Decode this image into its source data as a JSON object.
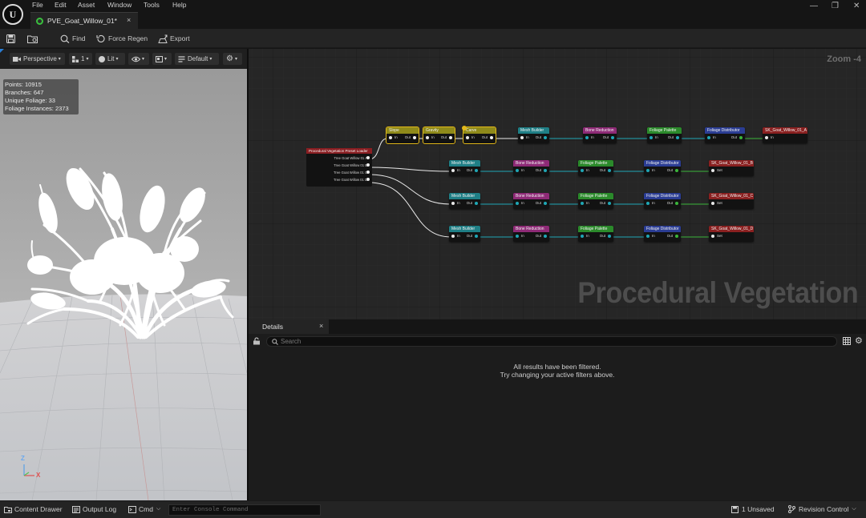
{
  "menu": {
    "items": [
      "File",
      "Edit",
      "Asset",
      "Window",
      "Tools",
      "Help"
    ]
  },
  "document_tab": {
    "label": "PVE_Goat_Willow_01*",
    "close": "×"
  },
  "window_controls": {
    "minimize": "—",
    "maximize": "❐",
    "close": "✕"
  },
  "toolbar": {
    "find_label": "Find",
    "force_regen_label": "Force Regen",
    "export_label": "Export"
  },
  "viewport": {
    "view_mode": "Perspective",
    "camera_speed": "1",
    "lighting_mode": "Lit",
    "profile": "Default",
    "stats": {
      "points": "Points: 10915",
      "branches": "Branches: 647",
      "unique_foliage": "Unique Foliage: 33",
      "foliage_instances": "Foliage Instances: 2373"
    },
    "axis": {
      "z": "Z",
      "x": "X"
    }
  },
  "graph": {
    "zoom_label": "Zoom -4",
    "watermark": "Procedural Vegetation",
    "loader": {
      "title": "Procedural Vegetation Preset Loader",
      "outputs": [
        "Tree Goat Willow 01 A",
        "Tree Goat Willow 01 B",
        "Tree Goat Willow 01 C",
        "Tree Goat Willow 01 D"
      ]
    },
    "row_a": [
      "Slope",
      "Gravity",
      "Carve",
      "Mesh Builder",
      "Bone Reduction",
      "Foliage Palette",
      "Foliage Distributor",
      "SK_Goat_Willow_01_A"
    ],
    "row_b": [
      "Mesh Builder",
      "Bone Reduction",
      "Foliage Palette",
      "Foliage Distributor",
      "SK_Goat_Willow_01_B"
    ],
    "row_c": [
      "Mesh Builder",
      "Bone Reduction",
      "Foliage Palette",
      "Foliage Distributor",
      "SK_Goat_Willow_01_C"
    ],
    "row_d": [
      "Mesh Builder",
      "Bone Reduction",
      "Foliage Palette",
      "Foliage Distributor",
      "SK_Goat_Willow_01_D"
    ],
    "pin_in": "In",
    "pin_out": "Out",
    "pin_set": "Set",
    "colors": {
      "slope": "#8f8a1a",
      "mesh_builder": "#1f7f86",
      "bone_reduction": "#8e2a76",
      "foliage_palette": "#2b8a2b",
      "foliage_distributor": "#2b3d94",
      "output": "#8a2020",
      "wire": "#1fa7b5"
    }
  },
  "details": {
    "tab_label": "Details",
    "tab_close": "×",
    "search_placeholder": "Search",
    "empty_line1": "All results have been filtered.",
    "empty_line2": "Try changing your active filters above."
  },
  "statusbar": {
    "content_drawer": "Content Drawer",
    "output_log": "Output Log",
    "cmd": "Cmd",
    "console_placeholder": "Enter Console Command",
    "unsaved": "1 Unsaved",
    "revision_control": "Revision Control"
  }
}
